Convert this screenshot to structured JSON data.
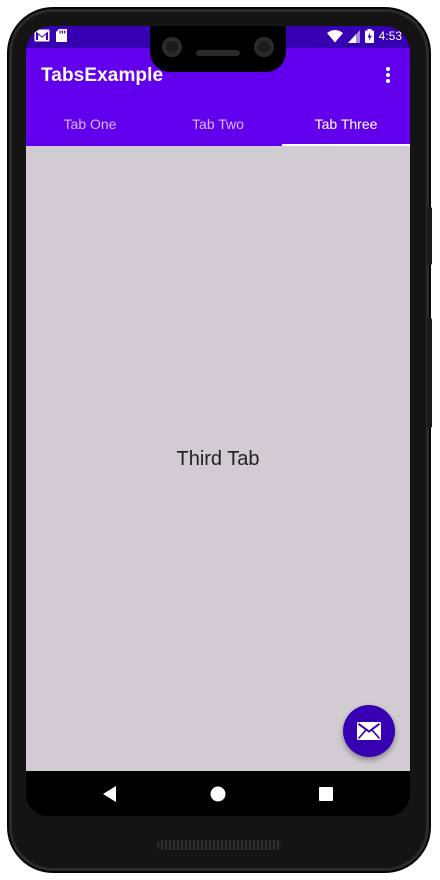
{
  "status_bar": {
    "time": "4:53",
    "icons": [
      "gmail-icon",
      "sd-card-icon",
      "wifi-icon",
      "signal-icon",
      "battery-charging-icon"
    ]
  },
  "app_bar": {
    "title": "TabsExample",
    "overflow_icon": "more-vert-icon"
  },
  "tabs": [
    {
      "label": "Tab One",
      "selected": false
    },
    {
      "label": "Tab Two",
      "selected": false
    },
    {
      "label": "Tab Three",
      "selected": true
    }
  ],
  "content": {
    "label": "Third Tab"
  },
  "fab": {
    "icon": "email-icon"
  },
  "nav_bar": {
    "icons": [
      "back-icon",
      "home-icon",
      "recents-icon"
    ]
  },
  "colors": {
    "primary": "#6200ee",
    "primary_dark": "#3700b3",
    "content_background": "#d1ccd1"
  }
}
